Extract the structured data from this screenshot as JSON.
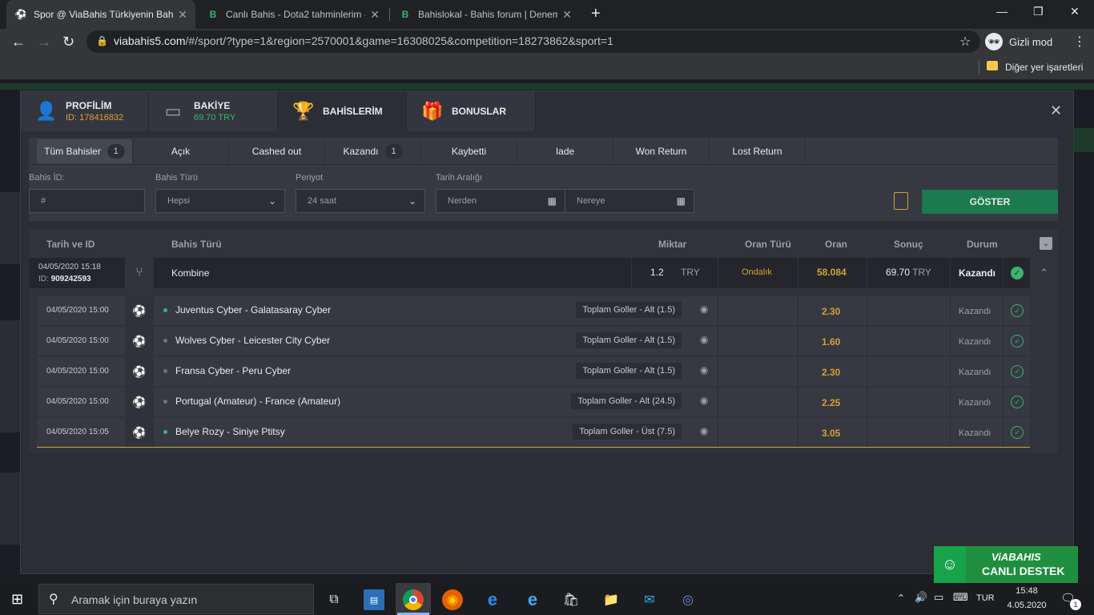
{
  "browser": {
    "tabs": [
      {
        "title": "Spor @ ViaBahis Türkiyenin Bahis",
        "active": true
      },
      {
        "title": "Canlı Bahis - Dota2 tahminlerim -",
        "active": false
      },
      {
        "title": "Bahislokal - Bahis forum | Denem",
        "active": false
      }
    ],
    "url_domain": "viabahis5.com",
    "url_path": "/#/sport/?type=1&region=2570001&game=16308025&competition=18273862&sport=1",
    "incognito_label": "Gizli mod",
    "bookmarks_label": "Diğer yer işaretleri"
  },
  "modal": {
    "tabs": [
      {
        "label": "PROFİLİM",
        "sub": "ID: 178416832",
        "icon": "user-icon"
      },
      {
        "label": "BAKİYE",
        "sub": "69.70 TRY",
        "icon": "wallet-icon"
      },
      {
        "label": "BAHİSLERİM",
        "sub": "",
        "icon": "trophy-icon"
      },
      {
        "label": "BONUSLAR",
        "sub": "",
        "icon": "gift-icon"
      }
    ],
    "filter_tabs": [
      {
        "label": "Tüm Bahisler",
        "count": "1"
      },
      {
        "label": "Açık",
        "count": ""
      },
      {
        "label": "Cashed out",
        "count": ""
      },
      {
        "label": "Kazandı",
        "count": "1"
      },
      {
        "label": "Kaybetti",
        "count": ""
      },
      {
        "label": "Iade",
        "count": ""
      },
      {
        "label": "Won Return",
        "count": ""
      },
      {
        "label": "Lost Return",
        "count": ""
      }
    ],
    "filters": {
      "bet_id_label": "Bahis İD:",
      "bet_id_placeholder": "#",
      "bet_type_label": "Bahis Türü",
      "bet_type_value": "Hepsi",
      "period_label": "Periyot",
      "period_value": "24 saat",
      "date_range_label": "Tarih Aralığı",
      "date_from": "Nerden",
      "date_to": "Nereye",
      "show_button": "GÖSTER"
    },
    "columns": {
      "date_id": "Tarih ve ID",
      "bet_type": "Bahis Türü",
      "amount": "Miktar",
      "odds_type": "Oran Türü",
      "odds": "Oran",
      "result": "Sonuç",
      "status": "Durum"
    },
    "bet": {
      "datetime": "04/05/2020 15:18",
      "id_label": "ID:",
      "id": "909242593",
      "type": "Kombine",
      "amount": "1.2",
      "currency": "TRY",
      "odds_type": "Ondalık",
      "odds": "58.084",
      "result": "69.70",
      "result_currency": "TRY",
      "status": "Kazandı"
    },
    "legs": [
      {
        "time": "04/05/2020 15:00",
        "match": "Juventus Cyber - Galatasaray Cyber",
        "market": "Toplam Goller - Alt (1.5)",
        "odds": "2.30",
        "status": "Kazandı",
        "live": true
      },
      {
        "time": "04/05/2020 15:00",
        "match": "Wolves Cyber - Leicester City Cyber",
        "market": "Toplam Goller - Alt (1.5)",
        "odds": "1.60",
        "status": "Kazandı",
        "live": false
      },
      {
        "time": "04/05/2020 15:00",
        "match": "Fransa Cyber - Peru Cyber",
        "market": "Toplam Goller - Alt (1.5)",
        "odds": "2.30",
        "status": "Kazandı",
        "live": false
      },
      {
        "time": "04/05/2020 15:00",
        "match": "Portugal (Amateur) - France (Amateur)",
        "market": "Toplam Goller - Alt (24.5)",
        "odds": "2.25",
        "status": "Kazandı",
        "live": false
      },
      {
        "time": "04/05/2020 15:05",
        "match": "Belye Rozy - Siniye Ptitsy",
        "market": "Toplam Goller - Üst (7.5)",
        "odds": "3.05",
        "status": "Kazandı",
        "live": true
      }
    ]
  },
  "support": {
    "brand": "ViABAHIS",
    "label": "CANLI DESTEK"
  },
  "taskbar": {
    "search_placeholder": "Aramak için buraya yazın",
    "lang": "TUR",
    "time": "15:48",
    "date": "4.05.2020",
    "notifications": "1"
  },
  "colors": {
    "accent_green": "#1b7a4e",
    "odds_gold": "#d4a03a",
    "balance_green": "#3cb371",
    "id_orange": "#e0a030"
  }
}
